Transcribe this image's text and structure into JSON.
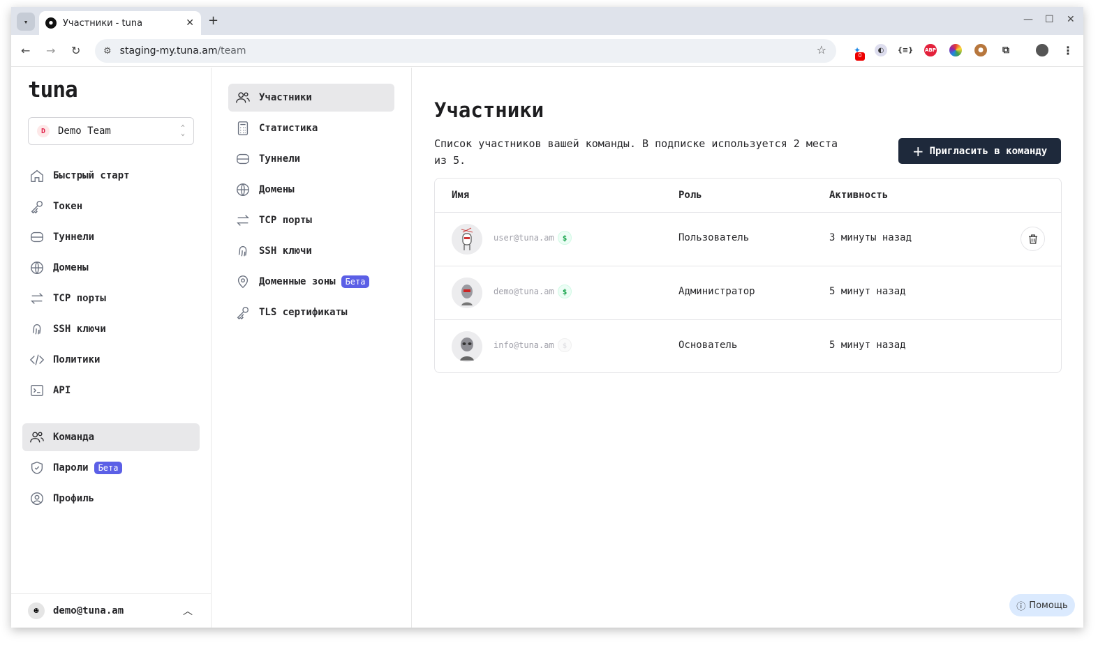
{
  "browser": {
    "tab_title": "Участники - tuna",
    "url_host": "staging-my.tuna.am",
    "url_path": "/team",
    "ext_badge": "0"
  },
  "app": {
    "logo": "tuna",
    "team_initial": "D",
    "team_name": "Demo Team"
  },
  "sidebar": {
    "items": [
      {
        "label": "Быстрый старт",
        "icon": "home-icon"
      },
      {
        "label": "Токен",
        "icon": "key-icon"
      },
      {
        "label": "Туннели",
        "icon": "tunnels-icon"
      },
      {
        "label": "Домены",
        "icon": "globe-icon"
      },
      {
        "label": "TCP порты",
        "icon": "arrows-icon"
      },
      {
        "label": "SSH ключи",
        "icon": "fingerprint-icon"
      },
      {
        "label": "Политики",
        "icon": "code-icon"
      },
      {
        "label": "API",
        "icon": "terminal-icon"
      }
    ],
    "items2": [
      {
        "label": "Команда",
        "icon": "users-icon"
      },
      {
        "label": "Пароли",
        "icon": "shield-icon",
        "badge": "Бета"
      },
      {
        "label": "Профиль",
        "icon": "user-circle-icon"
      }
    ],
    "user_email": "demo@tuna.am"
  },
  "subnav": {
    "items": [
      {
        "label": "Участники",
        "icon": "users-icon"
      },
      {
        "label": "Статистика",
        "icon": "calculator-icon"
      },
      {
        "label": "Туннели",
        "icon": "tunnels-icon"
      },
      {
        "label": "Домены",
        "icon": "globe-icon"
      },
      {
        "label": "TCP порты",
        "icon": "arrows-icon"
      },
      {
        "label": "SSH ключи",
        "icon": "fingerprint-icon"
      },
      {
        "label": "Доменные зоны",
        "icon": "location-icon",
        "badge": "Бета"
      },
      {
        "label": "TLS сертификаты",
        "icon": "key-icon"
      }
    ]
  },
  "main": {
    "title": "Участники",
    "description": "Список участников вашей команды. В подписке используется 2 места из 5.",
    "invite_label": "Пригласить в команду",
    "columns": [
      "Имя",
      "Роль",
      "Активность"
    ],
    "rows": [
      {
        "email": "user@tuna.am",
        "paid": true,
        "role": "Пользователь",
        "activity": "3 минуты назад",
        "deletable": true
      },
      {
        "email": "demo@tuna.am",
        "paid": true,
        "role": "Администратор",
        "activity": "5 минут назад",
        "deletable": false
      },
      {
        "email": "info@tuna.am",
        "paid": false,
        "role": "Основатель",
        "activity": "5 минут назад",
        "deletable": false
      }
    ],
    "help_label": "Помощь"
  },
  "colors": {
    "accent_dark": "#1e293b",
    "beta_badge": "#5b5fe6",
    "paid_green": "#16a34a"
  }
}
